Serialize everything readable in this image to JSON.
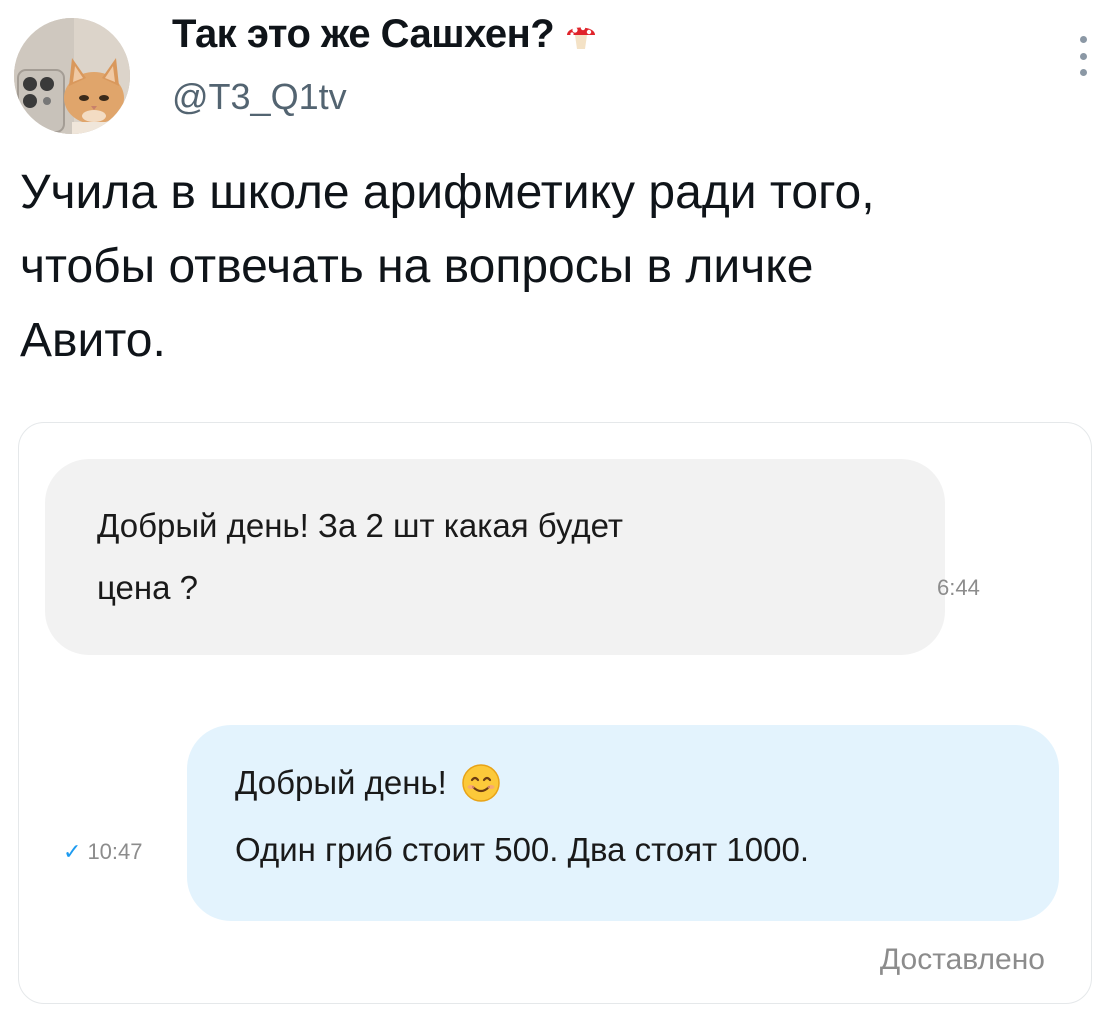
{
  "tweet": {
    "display_name": "Так это же Сашхен?",
    "name_emoji_icon": "mushroom-icon",
    "handle": "@T3_Q1tv",
    "text": "Учила в школе арифметику ради того,\nчтобы отвечать на вопросы в личке\nАвито."
  },
  "chat": {
    "incoming": {
      "text": "Добрый день! За 2 шт какая будет\nцена ?",
      "time": "6:44"
    },
    "outgoing": {
      "line1": "Добрый день!",
      "emoji_icon": "smiling-face-icon",
      "line2": "Один гриб стоит 500. Два стоят 1000.",
      "time": "10:47",
      "status_icon": "checkmark-icon"
    },
    "status": "Доставлено"
  },
  "colors": {
    "incoming_bubble": "#f2f2f2",
    "outgoing_bubble": "#e3f3fd",
    "check": "#1d9bf0",
    "muted": "#8c8c8c",
    "handle": "#536471"
  }
}
